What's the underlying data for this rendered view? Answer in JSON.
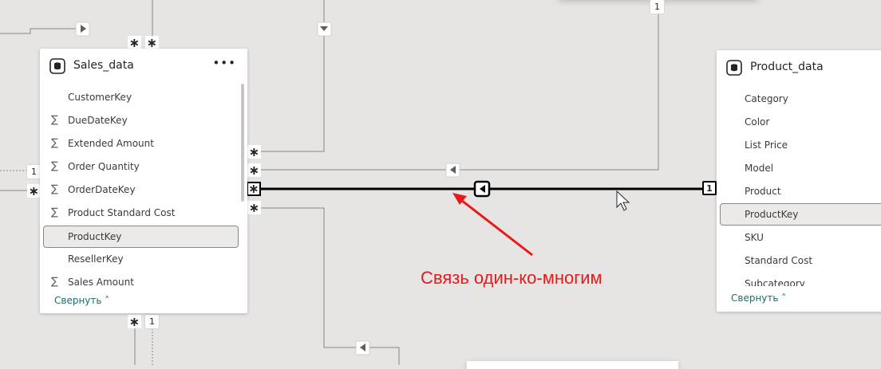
{
  "tables": {
    "sales": {
      "title": "Sales_data",
      "menu_icon": "more-icon",
      "fields": [
        {
          "name": "CustomerKey",
          "sigma": false
        },
        {
          "name": "DueDateKey",
          "sigma": true
        },
        {
          "name": "Extended Amount",
          "sigma": true
        },
        {
          "name": "Order Quantity",
          "sigma": true
        },
        {
          "name": "OrderDateKey",
          "sigma": true
        },
        {
          "name": "Product Standard Cost",
          "sigma": true
        },
        {
          "name": "ProductKey",
          "sigma": false,
          "selected": true
        },
        {
          "name": "ResellerKey",
          "sigma": false
        },
        {
          "name": "Sales Amount",
          "sigma": true
        }
      ],
      "collapse_label": "Свернуть"
    },
    "product": {
      "title": "Product_data",
      "fields": [
        {
          "name": "Category",
          "sigma": false
        },
        {
          "name": "Color",
          "sigma": false
        },
        {
          "name": "List Price",
          "sigma": false
        },
        {
          "name": "Model",
          "sigma": false
        },
        {
          "name": "Product",
          "sigma": false
        },
        {
          "name": "ProductKey",
          "sigma": false,
          "selected": true
        },
        {
          "name": "SKU",
          "sigma": false
        },
        {
          "name": "Standard Cost",
          "sigma": false
        },
        {
          "name": "Subcategory",
          "sigma": false
        }
      ],
      "collapse_label": "Свернуть"
    }
  },
  "cardinality": {
    "many": "∗",
    "one": "1"
  },
  "annotation": {
    "text": "Связь один-ко-многим",
    "color": "#e8191b"
  },
  "colors": {
    "canvas": "#e6e5e4",
    "relationship": "#000000",
    "connector": "#8a8886",
    "link": "#1d6d6e"
  },
  "sigma_symbol": "∑",
  "collapse_chevron": "^"
}
